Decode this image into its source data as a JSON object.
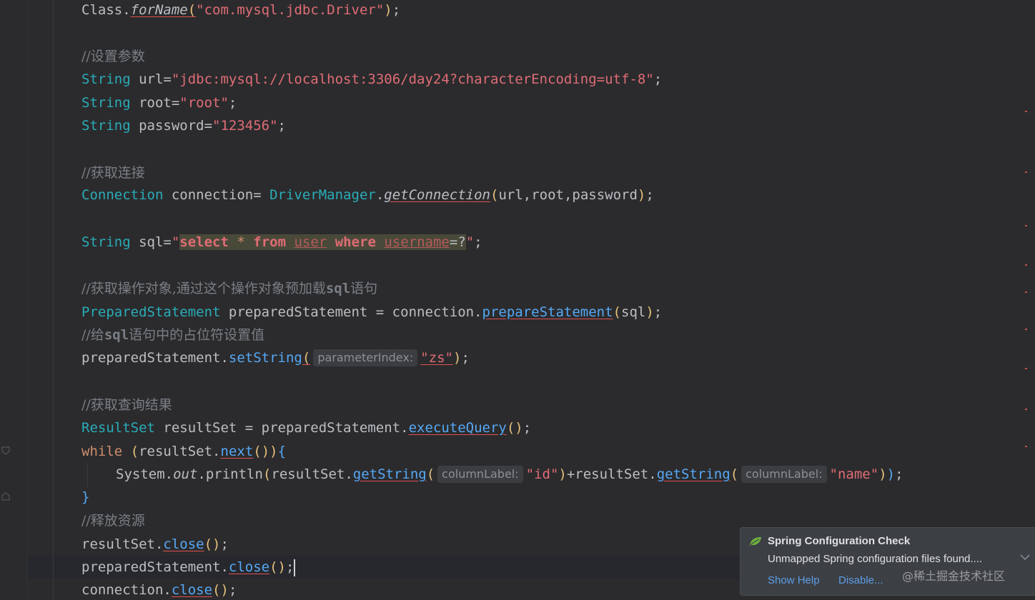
{
  "lines": {
    "l1": {
      "a": "Class.",
      "b": "forName",
      "c": "(",
      "d": "\"com.mysql.jdbc.Driver\"",
      "e": ")",
      "f": ";"
    },
    "l2": {
      "c": "//设置参数"
    },
    "l3": {
      "a": "String",
      "b": " url=",
      "c": "\"jdbc:mysql://localhost:3306/day24?characterEncoding=utf-8\"",
      "d": ";"
    },
    "l4": {
      "a": "String",
      "b": " root=",
      "c": "\"root\"",
      "d": ";"
    },
    "l5": {
      "a": "String",
      "b": " password=",
      "c": "\"123456\"",
      "d": ";"
    },
    "l6": {
      "c": "//获取连接"
    },
    "l7": {
      "a": "Connection",
      "b": " connection= ",
      "c": "DriverManager",
      "d": ".",
      "e": "getConnection",
      "f": "(",
      "g": "url,root,password",
      "h": ")",
      "i": ";"
    },
    "l8": {
      "a": "String",
      "b": " sql=",
      "q1": "\"",
      "s1": "select",
      "s2": " * ",
      "s3": "from",
      "s4": " ",
      "s5": "user",
      "s6": " ",
      "s7": "where",
      "s8": " ",
      "s9": "username",
      "s10": "=?",
      "q2": "\"",
      "e": ";"
    },
    "l9": {
      "c1": "//获取操作对象,通过这个操作对象预加载",
      "c2": "sql",
      "c3": "语句"
    },
    "l10": {
      "a": "PreparedStatement",
      "b": " preparedStatement = connection.",
      "c": "prepareStatement",
      "d": "(",
      "e": "sql",
      "f": ")",
      "g": ";"
    },
    "l11": {
      "c1": "//给",
      "c2": "sql",
      "c3": "语句中的占位符设置值"
    },
    "l12": {
      "a": "preparedStatement.",
      "b": "setString",
      "c": "(",
      "hint": "parameterIndex:",
      "d": "\"zs\"",
      "e": ")",
      "f": ";"
    },
    "l13": {
      "c": "//获取查询结果"
    },
    "l14": {
      "a": "ResultSet",
      "b": " resultSet = preparedStatement.",
      "c": "executeQuery",
      "d": "()",
      "e": ";"
    },
    "l15": {
      "a": "while",
      "b": " ",
      "c": "(",
      "d": "resultSet.",
      "e": "next",
      "f": "()",
      "g": ")",
      "h": "{"
    },
    "l16": {
      "a": "System.",
      "b": "out",
      "c": ".println",
      "d": "(",
      "e": "resultSet.",
      "f": "getString",
      "g": "(",
      "hint1": "columnLabel:",
      "h": "\"id\"",
      "i": ")",
      "j": "+resultSet.",
      "k": "getString",
      "l": "(",
      "hint2": "columnLabel:",
      "m": "\"name\"",
      "n": ")",
      "o": ")",
      "p": ";"
    },
    "l17": {
      "a": "}"
    },
    "l18": {
      "c": "//释放资源"
    },
    "l19": {
      "a": "resultSet.",
      "b": "close",
      "c": "()",
      "d": ";"
    },
    "l20": {
      "a": "preparedStatement.",
      "b": "close",
      "c": "()",
      "d": ";"
    },
    "l21": {
      "a": "connection.",
      "b": "close",
      "c": "()",
      "d": ";"
    }
  },
  "notification": {
    "title": "Spring Configuration Check",
    "body": "Unmapped Spring configuration files found....",
    "show_help": "Show Help",
    "disable": "Disable...",
    "leaf_icon": "spring-leaf-icon",
    "chevron_icon": "chevron-down-icon"
  },
  "watermark": "@稀土掘金技术社区",
  "colors": {
    "background": "#2b2b2d",
    "keyword": "#cf8e6d",
    "type": "#56a8f5",
    "string": "#e06c75",
    "comment": "#7a7e85",
    "link": "#5e9ee8"
  }
}
